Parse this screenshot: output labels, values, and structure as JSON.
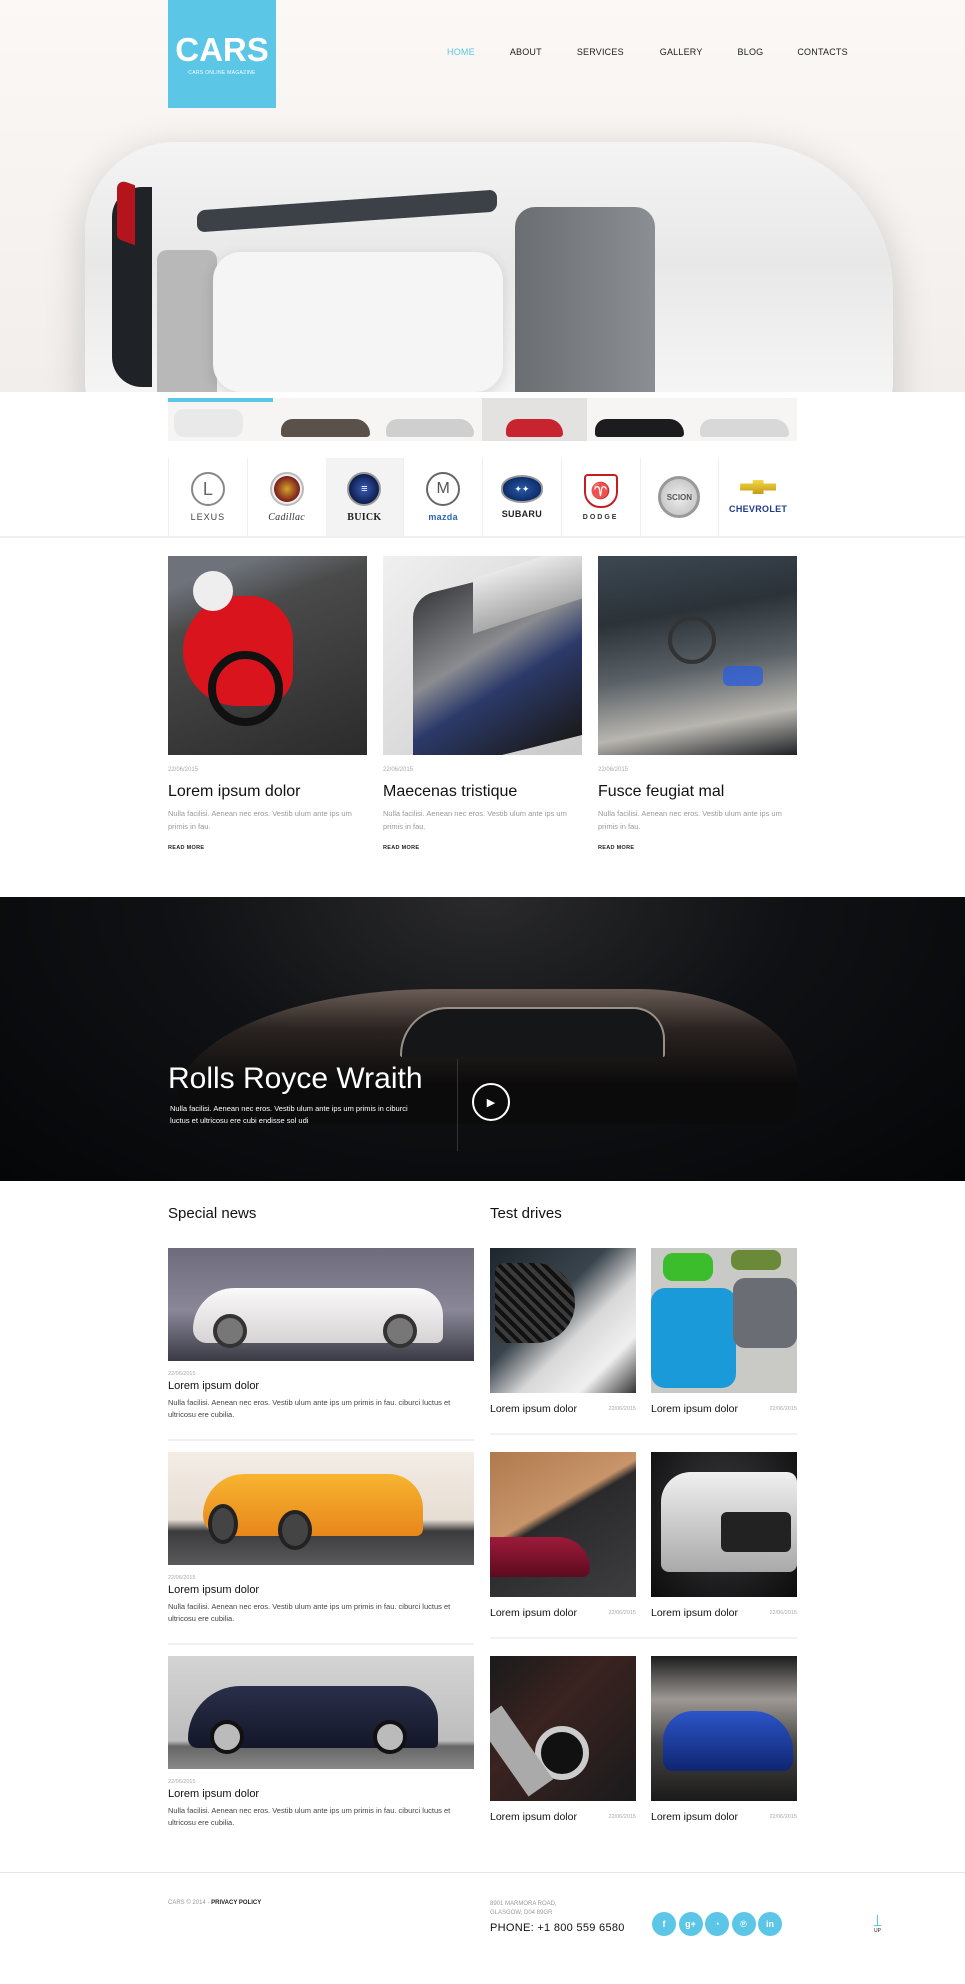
{
  "header": {
    "logo_title": "CARS",
    "logo_subtitle": "CARS ONLINE MAGAZINE",
    "nav": [
      {
        "label": "HOME",
        "active": true
      },
      {
        "label": "ABOUT",
        "active": false
      },
      {
        "label": "SERVICES",
        "active": false
      },
      {
        "label": "GALLERY",
        "active": false
      },
      {
        "label": "BLOG",
        "active": false
      },
      {
        "label": "CONTACTS",
        "active": false
      }
    ]
  },
  "colors": {
    "accent": "#5cc6e6",
    "banner_bg": "#050608",
    "text": "#111111"
  },
  "thumbnails": [
    {
      "name": "white-car-top",
      "active": true
    },
    {
      "name": "brown-sports-car"
    },
    {
      "name": "silver-sedan"
    },
    {
      "name": "red-motorcycle",
      "selected": true
    },
    {
      "name": "black-coupe"
    },
    {
      "name": "white-hypercar"
    }
  ],
  "brands": [
    {
      "name": "LEXUS",
      "icon": "lexus-logo-icon"
    },
    {
      "name": "Cadillac",
      "icon": "cadillac-logo-icon"
    },
    {
      "name": "BUICK",
      "icon": "buick-logo-icon",
      "selected": true
    },
    {
      "name": "mazda",
      "icon": "mazda-logo-icon"
    },
    {
      "name": "SUBARU",
      "icon": "subaru-logo-icon"
    },
    {
      "name": "DODGE",
      "icon": "dodge-logo-icon"
    },
    {
      "name": "SCION",
      "icon": "scion-logo-icon"
    },
    {
      "name": "CHEVROLET",
      "icon": "chevrolet-logo-icon"
    }
  ],
  "articles": [
    {
      "date": "22/06/2015",
      "title": "Lorem ipsum dolor",
      "desc": "Nulla facilisi. Aenean nec eros. Vestib ulum ante ips um primis in fau.",
      "more": "READ MORE",
      "image": "red-motorcycle-image"
    },
    {
      "date": "22/06/2015",
      "title": "Maecenas tristique",
      "desc": "Nulla facilisi. Aenean nec eros. Vestib ulum ante ips um primis in fau.",
      "more": "READ MORE",
      "image": "engine-image"
    },
    {
      "date": "22/06/2015",
      "title": "Fusce feugiat mal",
      "desc": "Nulla facilisi. Aenean nec eros. Vestib ulum ante ips um primis in fau.",
      "more": "READ MORE",
      "image": "car-interior-image"
    }
  ],
  "banner": {
    "title": "Rolls Royce Wraith",
    "desc": "Nulla facilisi. Aenean nec eros. Vestib ulum ante ips um primis in ciburci luctus et ultricosu ere cubi endisse sol udi"
  },
  "special_news": {
    "heading": "Special news",
    "items": [
      {
        "date": "22/06/2015",
        "title": "Lorem ipsum dolor",
        "desc": "Nulla facilisi. Aenean nec eros. Vestib ulum ante ips um primis in fau. ciburci luctus et ultricosu ere cubilia.",
        "image": "white-convertible-image"
      },
      {
        "date": "22/06/2015",
        "title": "Lorem ipsum dolor",
        "desc": "Nulla facilisi. Aenean nec eros. Vestib ulum ante ips um primis in fau. ciburci luctus et ultricosu ere cubilia.",
        "image": "orange-supercar-image"
      },
      {
        "date": "22/06/2015",
        "title": "Lorem ipsum dolor",
        "desc": "Nulla facilisi. Aenean nec eros. Vestib ulum ante ips um primis in fau. ciburci luctus et ultricosu ere cubilia.",
        "image": "navy-coupe-image"
      }
    ]
  },
  "test_drives": {
    "heading": "Test drives",
    "items": [
      {
        "title": "Lorem ipsum dolor",
        "date": "22/06/2015",
        "image": "grille-closeup-image"
      },
      {
        "title": "Lorem ipsum dolor",
        "date": "22/06/2015",
        "image": "muscle-cars-image"
      },
      {
        "title": "Lorem ipsum dolor",
        "date": "22/06/2015",
        "image": "taillight-deck-image"
      },
      {
        "title": "Lorem ipsum dolor",
        "date": "22/06/2015",
        "image": "silver-suv-image"
      },
      {
        "title": "Lorem ipsum dolor",
        "date": "22/06/2015",
        "image": "console-controls-image"
      },
      {
        "title": "Lorem ipsum dolor",
        "date": "22/06/2015",
        "image": "blue-coupe-image"
      }
    ]
  },
  "footer": {
    "copyright": "CARS © 2014 - ",
    "privacy": "PRIVACY POLICY",
    "address_line1": "8901 MARMORA ROAD,",
    "address_line2": "GLASGOW, D04 89GR",
    "phone": "PHONE:  +1 800 559 6580",
    "social": [
      {
        "name": "facebook",
        "glyph": "f"
      },
      {
        "name": "google-plus",
        "glyph": "g+"
      },
      {
        "name": "rss",
        "glyph": "◔"
      },
      {
        "name": "pinterest",
        "glyph": "℗"
      },
      {
        "name": "linkedin",
        "glyph": "in"
      }
    ],
    "up_label": "UP"
  }
}
